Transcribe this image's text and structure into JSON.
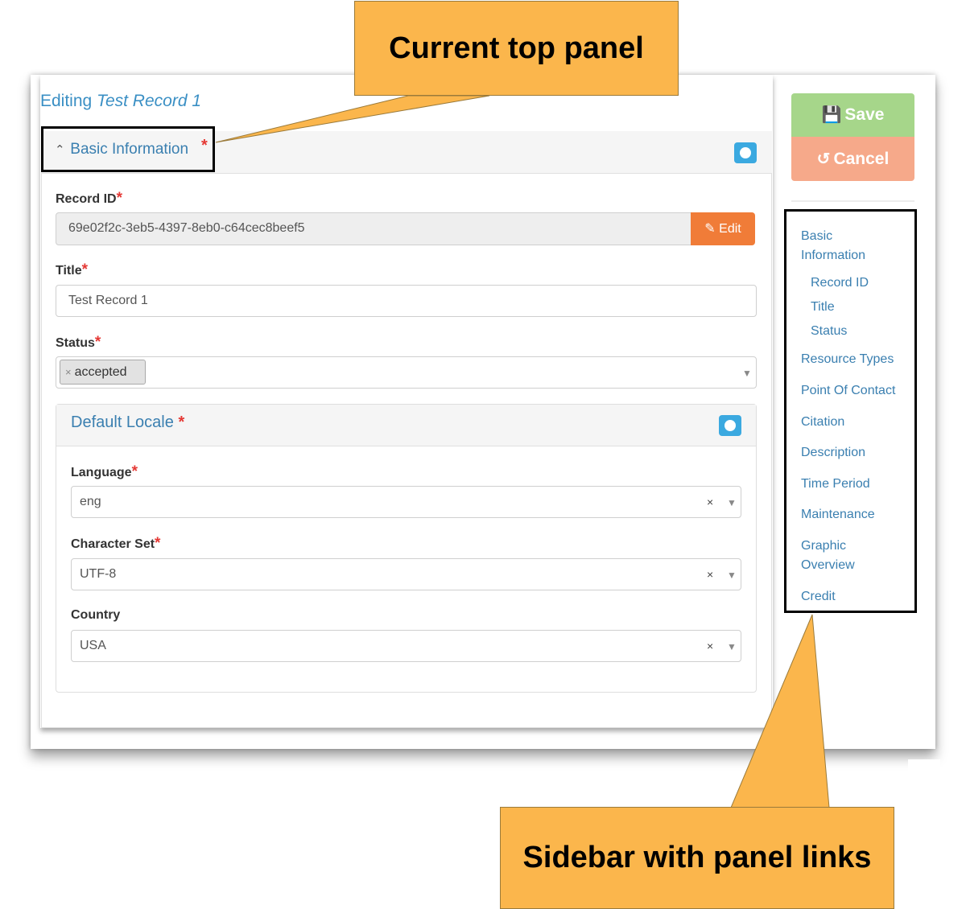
{
  "header": {
    "editing_prefix": "Editing",
    "record_name": "Test Record 1"
  },
  "panel": {
    "title": "Basic Information",
    "required_mark": "*",
    "fields": {
      "record_id": {
        "label": "Record ID",
        "value": "69e02f2c-3eb5-4397-8eb0-c64cec8beef5",
        "edit_label": "Edit"
      },
      "title": {
        "label": "Title",
        "value": "Test Record 1"
      },
      "status": {
        "label": "Status",
        "tag_remove": "×",
        "selected": "accepted"
      }
    },
    "default_locale": {
      "title": "Default Locale",
      "language": {
        "label": "Language",
        "value": "eng"
      },
      "character_set": {
        "label": "Character Set",
        "value": "UTF-8"
      },
      "country": {
        "label": "Country",
        "value": "USA"
      },
      "clear_glyph": "×",
      "caret_glyph": "▼"
    }
  },
  "actions": {
    "save_label": "Save",
    "cancel_label": "Cancel"
  },
  "sidebar": {
    "items": [
      {
        "label": "Basic Information",
        "level": 0
      },
      {
        "label": "Record ID",
        "level": 1
      },
      {
        "label": "Title",
        "level": 1
      },
      {
        "label": "Status",
        "level": 1
      },
      {
        "label": "Resource Types",
        "level": 0
      },
      {
        "label": "Point Of Contact",
        "level": 0
      },
      {
        "label": "Citation",
        "level": 0
      },
      {
        "label": "Description",
        "level": 0
      },
      {
        "label": "Time Period",
        "level": 0
      },
      {
        "label": "Maintenance",
        "level": 0
      },
      {
        "label": "Graphic Overview",
        "level": 0
      },
      {
        "label": "Credit",
        "level": 0
      }
    ]
  },
  "callouts": {
    "top": "Current top panel",
    "bottom": "Sidebar with panel links"
  },
  "colors": {
    "accent_link": "#3a7fb0",
    "save": "#a6d68a",
    "cancel": "#f6a98a",
    "edit": "#f07c38",
    "callout": "#fbb64c",
    "required": "#e53935"
  }
}
